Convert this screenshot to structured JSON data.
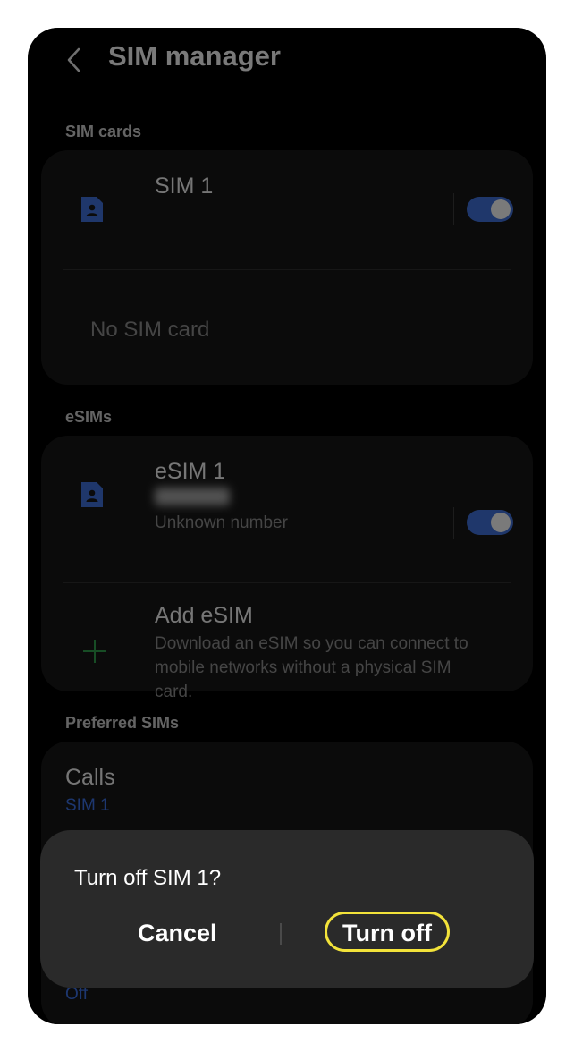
{
  "header": {
    "title": "SIM manager"
  },
  "sections": {
    "sim_cards": "SIM cards",
    "esims": "eSIMs",
    "preferred": "Preferred SIMs"
  },
  "sim1": {
    "name": "SIM 1",
    "enabled": true
  },
  "no_sim": "No SIM card",
  "esim1": {
    "name": "eSIM 1",
    "subtitle": "Unknown number",
    "enabled": true
  },
  "add_esim": {
    "title": "Add eSIM",
    "desc_line1": "Download an eSIM so you can connect to",
    "desc_line2": "mobile networks without a physical SIM",
    "desc_line3": "card."
  },
  "preferred": {
    "calls_label": "Calls",
    "calls_value": "SIM 1",
    "bottom_value": "Off"
  },
  "dialog": {
    "title": "Turn off SIM 1?",
    "cancel": "Cancel",
    "confirm": "Turn off"
  },
  "colors": {
    "accent": "#3f6fd6",
    "link": "#3b6fe0",
    "highlight": "#f3e33a",
    "add_icon": "#2e9b4a"
  }
}
